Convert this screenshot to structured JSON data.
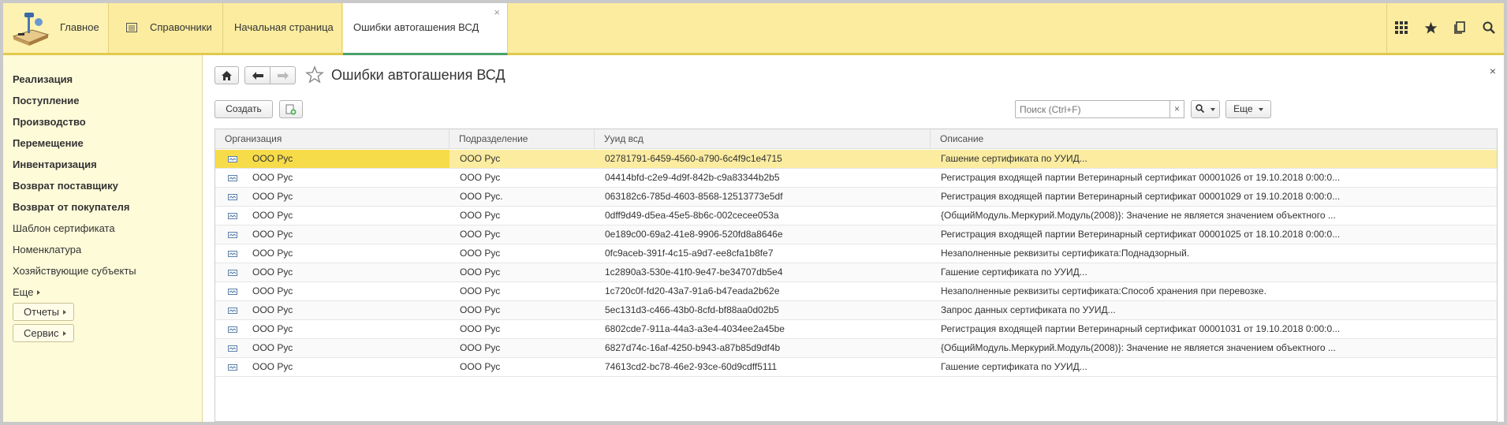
{
  "topbar": {
    "main_label": "Главное",
    "sections_label": "Справочники",
    "tabs": [
      {
        "label": "Начальная страница"
      },
      {
        "label": "Ошибки автогашения ВСД",
        "close": "×"
      }
    ],
    "icons": [
      "apps-grid-icon",
      "star-icon",
      "history-icon",
      "search-icon"
    ]
  },
  "sidebar": {
    "items": [
      {
        "label": "Реализация",
        "bold": true
      },
      {
        "label": "Поступление",
        "bold": true
      },
      {
        "label": "Производство",
        "bold": true
      },
      {
        "label": "Перемещение",
        "bold": true
      },
      {
        "label": "Инвентаризация",
        "bold": true
      },
      {
        "label": "Возврат поставщику",
        "bold": true
      },
      {
        "label": "Возврат от покупателя",
        "bold": true
      },
      {
        "label": "Шаблон сертификата",
        "bold": false
      },
      {
        "label": "Номенклатура",
        "bold": false
      },
      {
        "label": "Хозяйствующие субъекты",
        "bold": false
      }
    ],
    "more_label": "Еще",
    "reports_label": "Отчеты",
    "service_label": "Сервис"
  },
  "main": {
    "title": "Ошибки автогашения ВСД",
    "close": "×",
    "create_label": "Создать",
    "search_placeholder": "Поиск (Ctrl+F)",
    "search_clear": "×",
    "more_label": "Еще",
    "columns": [
      "Организация",
      "Подразделение",
      "Ууид всд",
      "Описание"
    ],
    "rows": [
      {
        "org": "ООО Рус",
        "dept": "ООО Рус",
        "uuid": "02781791-6459-4560-a790-6c4f9c1e4715",
        "desc": "Гашение сертификата по УУИД..."
      },
      {
        "org": "ООО Рус",
        "dept": "ООО Рус",
        "uuid": "04414bfd-c2e9-4d9f-842b-c9a83344b2b5",
        "desc": "Регистрация входящей партии Ветеринарный сертификат 00001026 от 19.10.2018 0:00:0..."
      },
      {
        "org": "ООО Рус",
        "dept": "ООО Рус.",
        "uuid": "063182c6-785d-4603-8568-12513773e5df",
        "desc": "Регистрация входящей партии Ветеринарный сертификат 00001029 от 19.10.2018 0:00:0..."
      },
      {
        "org": "ООО Рус",
        "dept": "ООО Рус",
        "uuid": "0dff9d49-d5ea-45e5-8b6c-002cecee053a",
        "desc": "{ОбщийМодуль.Меркурий.Модуль(2008)}: Значение не является значением объектного ..."
      },
      {
        "org": "ООО Рус",
        "dept": "ООО Рус",
        "uuid": "0e189c00-69a2-41e8-9906-520fd8a8646e",
        "desc": "Регистрация входящей партии Ветеринарный сертификат 00001025 от 18.10.2018 0:00:0..."
      },
      {
        "org": "ООО Рус",
        "dept": "ООО Рус",
        "uuid": "0fc9aceb-391f-4c15-a9d7-ee8cfa1b8fe7",
        "desc": "Незаполненные реквизиты сертификата:Поднадзорный."
      },
      {
        "org": "ООО Рус",
        "dept": "ООО Рус",
        "uuid": "1c2890a3-530e-41f0-9e47-be34707db5e4",
        "desc": "Гашение сертификата по УУИД..."
      },
      {
        "org": "ООО Рус",
        "dept": "ООО Рус",
        "uuid": "1c720c0f-fd20-43a7-91a6-b47eada2b62e",
        "desc": "Незаполненные реквизиты сертификата:Способ хранения при перевозке."
      },
      {
        "org": "ООО Рус",
        "dept": "ООО Рус",
        "uuid": "5ec131d3-c466-43b0-8cfd-bf88aa0d02b5",
        "desc": "Запрос данных сертификата по УУИД..."
      },
      {
        "org": "ООО Рус",
        "dept": "ООО Рус",
        "uuid": "6802cde7-911a-44a3-a3e4-4034ee2a45be",
        "desc": "Регистрация входящей партии Ветеринарный сертификат 00001031 от 19.10.2018 0:00:0..."
      },
      {
        "org": "ООО Рус",
        "dept": "ООО Рус",
        "uuid": "6827d74c-16af-4250-b943-a87b85d9df4b",
        "desc": "{ОбщийМодуль.Меркурий.Модуль(2008)}: Значение не является значением объектного ..."
      },
      {
        "org": "ООО Рус",
        "dept": "ООО Рус",
        "uuid": "74613cd2-bc78-46e2-93ce-60d9cdff5111",
        "desc": "Гашение сертификата по УУИД..."
      }
    ]
  },
  "colors": {
    "accent_yellow": "#fbeca0",
    "selected_row": "#fbeca0",
    "selected_cell": "#f7dc4a",
    "active_tab_underline": "#4aa06a"
  }
}
